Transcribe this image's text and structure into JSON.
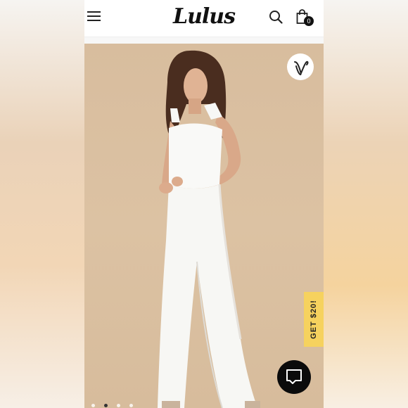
{
  "header": {
    "logo_text": "Lulus",
    "cart_count": "0",
    "icons": {
      "menu": "hamburger-menu-icon",
      "search": "search-icon",
      "bag": "shopping-bag-icon"
    }
  },
  "product_image": {
    "favorite_icon": "lulus-heart-logo-icon",
    "carousel_dot_count": 4,
    "carousel_active_index": 1
  },
  "promo_tab": {
    "label": "GET $20!"
  },
  "chat": {
    "icon": "chat-bubble-icon"
  },
  "colors": {
    "accent_yellow": "#f6d25e",
    "chat_button": "#0b0b0b",
    "backdrop": "#d8bd9e"
  }
}
